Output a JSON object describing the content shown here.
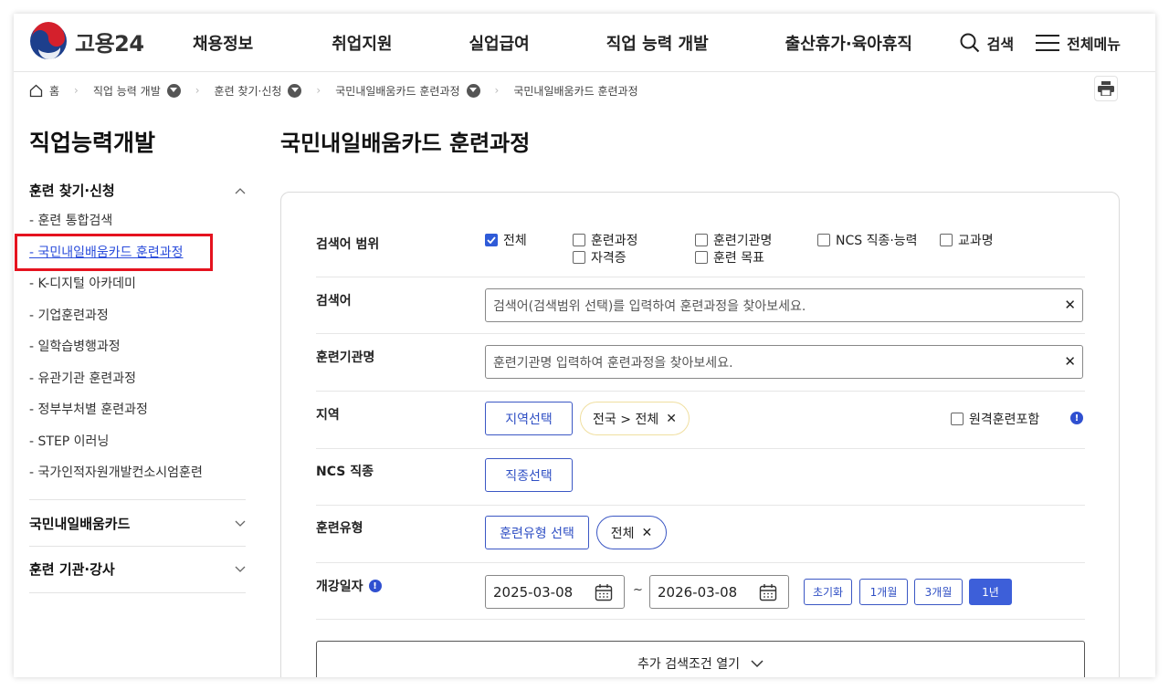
{
  "header": {
    "logo_text": "고용24",
    "nav": [
      "채용정보",
      "취업지원",
      "실업급여",
      "직업 능력 개발",
      "출산휴가·육아휴직"
    ],
    "search_label": "검색",
    "menu_label": "전체메뉴"
  },
  "breadcrumb": {
    "home": "홈",
    "items": [
      "직업 능력 개발",
      "훈련 찾기·신청",
      "국민내일배움카드 훈련과정",
      "국민내일배움카드 훈련과정"
    ]
  },
  "sidebar": {
    "title": "직업능력개발",
    "section1": "훈련 찾기·신청",
    "items": [
      "- 훈련 통합검색",
      "- 국민내일배움카드 훈련과정",
      "- K-디지털 아카데미",
      "- 기업훈련과정",
      "- 일학습병행과정",
      "- 유관기관 훈련과정",
      "- 정부부처별 훈련과정",
      "- STEP 이러닝",
      "- 국가인적자원개발컨소시엄훈련"
    ],
    "section2": "국민내일배움카드",
    "section3": "훈련 기관·강사"
  },
  "main": {
    "title": "국민내일배움카드 훈련과정",
    "scope_label": "검색어 범위",
    "scope_options": [
      "전체",
      "훈련과정",
      "훈련기관명",
      "NCS 직종·능력",
      "교과명",
      "자격증",
      "훈련 목표"
    ],
    "keyword_label": "검색어",
    "keyword_placeholder": "검색어(검색범위 선택)를 입력하여 훈련과정을 찾아보세요.",
    "org_label": "훈련기관명",
    "org_placeholder": "훈련기관명 입력하여 훈련과정을 찾아보세요.",
    "region_label": "지역",
    "region_button": "지역선택",
    "region_chip": "전국 > 전체",
    "remote_label": "원격훈련포함",
    "ncs_label": "NCS 직종",
    "ncs_button": "직종선택",
    "type_label": "훈련유형",
    "type_button": "훈련유형 선택",
    "type_chip": "전체",
    "date_label": "개강일자",
    "date_from": "2025-03-08",
    "date_tilde": "~",
    "date_to": "2026-03-08",
    "period_buttons": [
      "초기화",
      "1개월",
      "3개월",
      "1년"
    ],
    "more_button": "추가 검색조건 열기"
  },
  "colors": {
    "accent": "#3d5fd9",
    "highlight": "#e5131f",
    "chip_border": "#f0dfa0"
  }
}
